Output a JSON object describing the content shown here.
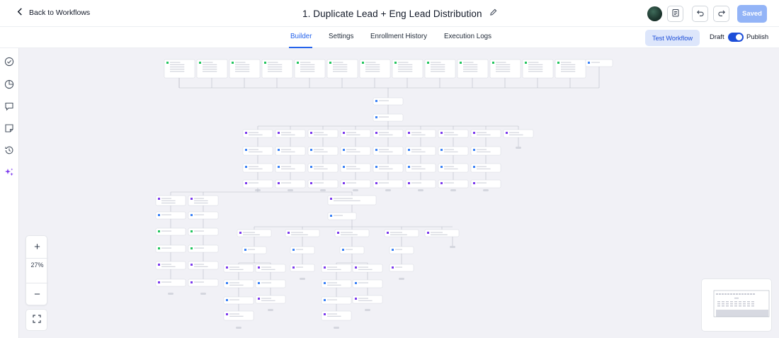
{
  "header": {
    "back_label": "Back to Workflows",
    "title": "1. Duplicate Lead + Eng Lead Distribution",
    "saved_label": "Saved"
  },
  "tabs": [
    {
      "label": "Builder",
      "active": true
    },
    {
      "label": "Settings",
      "active": false
    },
    {
      "label": "Enrollment History",
      "active": false
    },
    {
      "label": "Execution Logs",
      "active": false
    }
  ],
  "actions": {
    "test_workflow_label": "Test Workflow",
    "draft_label": "Draft",
    "publish_label": "Publish",
    "publish_on": true
  },
  "zoom": {
    "plus": "+",
    "level": "27%",
    "minus": "−"
  },
  "colors": {
    "accent": "#2563eb",
    "canvas_bg": "#f1f1f6",
    "trigger_icon": "#22c55e",
    "condition_icon": "#7c3aed",
    "action_icon": "#3b82f6"
  }
}
